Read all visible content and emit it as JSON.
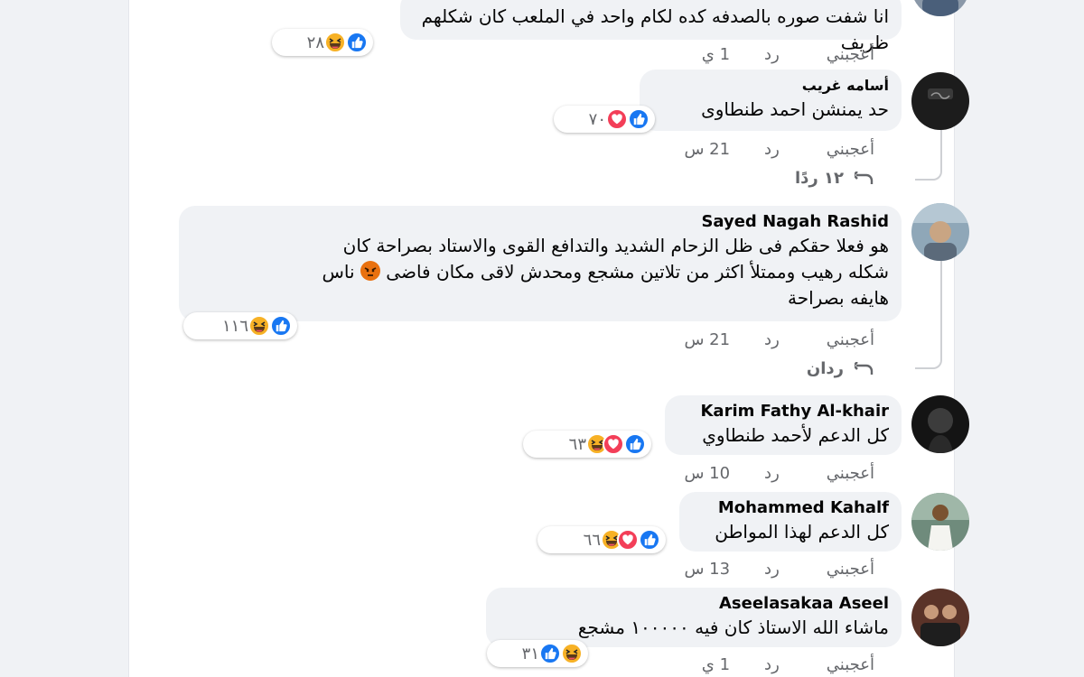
{
  "actions": {
    "like": "أعجبني",
    "reply": "رد"
  },
  "comments": [
    {
      "text": "انا شفت صوره بالصدفه كده لكام واحد في الملعب كان شكلهم ظريف",
      "reactions_count": "٢٨",
      "time": "1 ي"
    },
    {
      "author": "أسامه غريب",
      "text": "حد يمنشن احمد طنطاوى",
      "reactions_count": "٧٠",
      "time": "21 س",
      "replies": "١٢ ردًا"
    },
    {
      "author": "Sayed Nagah Rashid",
      "text_line1": "هو فعلا حقكم فى ظل الزحام الشديد والتدافع القوى والاستاد بصراحة كان",
      "text_line2a": "شكله رهيب وممتلأ اكثر من تلاتين مشجع ومحدش لاقى مكان فاضى",
      "text_line2b": "ناس",
      "text_line3": "هايفه بصراحة",
      "reactions_count": "١١٦",
      "time": "21 س",
      "replies": "ردان"
    },
    {
      "author": "Karim Fathy Al-khair",
      "text": "كل الدعم لأحمد طنطاوي",
      "reactions_count": "٦٣",
      "time": "10 س"
    },
    {
      "author": "Mohammed Kahalf",
      "text": "كل الدعم لهذا المواطن",
      "reactions_count": "٦٦",
      "time": "13 س"
    },
    {
      "author": "Aseelasakaa Aseel",
      "text": "ماشاء الله الاستاذ كان فيه ١٠٠٠٠٠ مشجع",
      "reactions_count": "٣١",
      "time": "1 ي"
    }
  ],
  "icons": {
    "like": "thumbs-up-icon",
    "love": "heart-icon",
    "haha": "laughing-face-icon",
    "angry": "angry-face-icon",
    "reply_arrow": "reply-arrow-icon"
  },
  "colors": {
    "like_blue": "#1877f2",
    "love_red": "#f33e58",
    "haha_yellow": "#f7b125",
    "muted_text": "#65676b",
    "bubble_bg": "#f0f2f5"
  }
}
